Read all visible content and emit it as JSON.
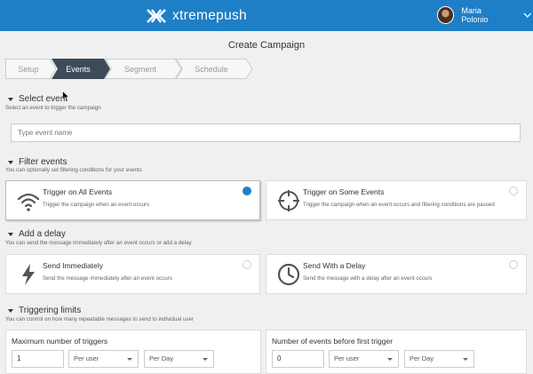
{
  "brand": {
    "name": "xtremepush",
    "accent": "#1f7fc6"
  },
  "user": {
    "name": "Maria Polonio"
  },
  "page": {
    "title": "Create Campaign"
  },
  "steps": [
    {
      "label": "Setup",
      "active": false
    },
    {
      "label": "Events",
      "active": true
    },
    {
      "label": "Segment",
      "active": false
    },
    {
      "label": "Schedule",
      "active": false
    }
  ],
  "select_event": {
    "title": "Select event",
    "subtitle": "Select an event to trigger the campaign",
    "input_placeholder": "Type event name",
    "input_value": ""
  },
  "filter_events": {
    "title": "Filter events",
    "subtitle": "You can optionally set filtering conditions for your events",
    "options": [
      {
        "title": "Trigger on All Events",
        "desc": "Trigger the campaign when an event occurs",
        "selected": true,
        "icon": "wifi-icon"
      },
      {
        "title": "Trigger on Some Events",
        "desc": "Trigger the campaign when an event occurs and filtering conditions are passed",
        "selected": false,
        "icon": "crosshair-icon"
      }
    ]
  },
  "delay": {
    "title": "Add a delay",
    "subtitle": "You can send the message immediately after an event occurs or add a delay",
    "options": [
      {
        "title": "Send Immediately",
        "desc": "Send the message immediately after an event occurs",
        "selected": false,
        "icon": "lightning-icon"
      },
      {
        "title": "Send With a Delay",
        "desc": "Send the message with a delay after an event occurs",
        "selected": false,
        "icon": "clock-icon"
      }
    ]
  },
  "limits": {
    "title": "Triggering limits",
    "subtitle": "You can control on how many repeatable messages to send to individual user",
    "max_triggers": {
      "label": "Maximum number of triggers",
      "value": "1",
      "per": "Per user",
      "period": "Per Day"
    },
    "events_before": {
      "label": "Number of events before first trigger",
      "value": "0",
      "per": "Per user",
      "period": "Per Day"
    }
  }
}
